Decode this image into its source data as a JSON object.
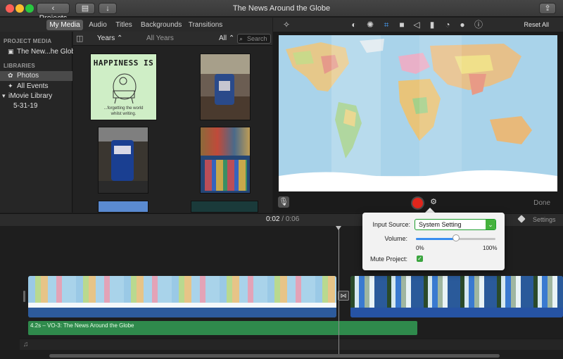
{
  "window": {
    "title": "The News Around the Globe",
    "projects_label": "Projects",
    "back_glyph": "‹",
    "media_toggle_glyph": "▤",
    "import_glyph": "↓",
    "share_glyph": "⇪"
  },
  "tabs": [
    {
      "label": "My Media",
      "active": true
    },
    {
      "label": "Audio",
      "active": false
    },
    {
      "label": "Titles",
      "active": false
    },
    {
      "label": "Backgrounds",
      "active": false
    },
    {
      "label": "Transitions",
      "active": false
    }
  ],
  "sidebar": {
    "project_media_header": "PROJECT MEDIA",
    "project_item": "The New...he Globe",
    "libraries_header": "LIBRARIES",
    "items": [
      {
        "label": "Photos",
        "selected": true
      },
      {
        "label": "All Events",
        "selected": false
      },
      {
        "label": "iMovie Library",
        "selected": false
      },
      {
        "label": "5-31-19",
        "selected": false
      }
    ]
  },
  "browser": {
    "years_label": "Years",
    "all_years_label": "All Years",
    "filter_label": "All",
    "search_placeholder": "Search"
  },
  "thumbnail_text": {
    "title": "HAPPINESS IS",
    "caption_line1": "...forgetting the world",
    "caption_line2": "whilst writing."
  },
  "viewer": {
    "reset_all": "Reset All",
    "done": "Done",
    "mic_glyph": "🎙",
    "options_glyph": "⚙"
  },
  "timeline": {
    "current_time": "0:02",
    "separator": "/",
    "total_time": "0:06",
    "settings": "Settings",
    "voiceover_clip": "4.2s – VO-3: The News Around the Globe",
    "transition_glyph": "⋈",
    "music_glyph": "♫"
  },
  "voiceover_popover": {
    "input_source_label": "Input Source:",
    "input_source_value": "System Setting",
    "volume_label": "Volume:",
    "volume_min": "0%",
    "volume_max": "100%",
    "volume_value": 0.5,
    "mute_label": "Mute Project:",
    "mute_checked": true
  },
  "colors": {
    "record": "#e0261c",
    "voiceover_clip": "#2f8a4c",
    "selection": "#4a4a4a",
    "check_green": "#3ba53f"
  }
}
